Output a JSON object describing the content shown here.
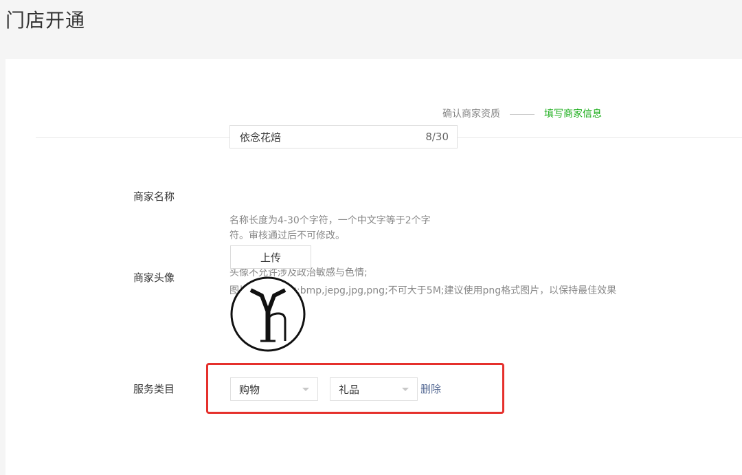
{
  "page": {
    "title": "门店开通"
  },
  "steps": {
    "step1": "确认商家资质",
    "step2": "填写商家信息",
    "active_color": "#1aad19"
  },
  "form": {
    "merchant_name": {
      "label": "商家名称",
      "value": "依念花焙",
      "count": "8/30",
      "hint_line1": "名称长度为4-30个字符，一个中文字等于2个字",
      "hint_line2": "符。审核通过后不可修改。"
    },
    "avatar": {
      "label": "商家头像",
      "hint_line1": "头像不允许涉及政治敏感与色情;",
      "hint_line2": "图片格式必须为:bmp,jepg,jpg,png;不可大于5M;建议使用png格式图片，以保持最佳效果",
      "upload_label": "上传",
      "image_icon": "avatar-logo-icon"
    },
    "category": {
      "label": "服务类目",
      "primary": "购物",
      "secondary": "礼品",
      "delete_label": "删除",
      "highlight_color": "#e5302c"
    }
  }
}
